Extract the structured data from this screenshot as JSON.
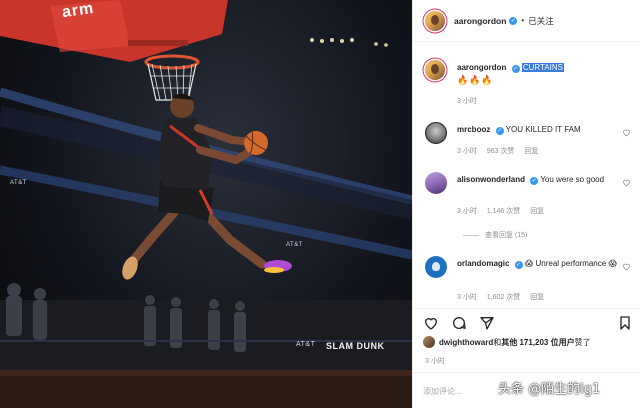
{
  "photo": {
    "description_icon": "basketball-dunk-photo",
    "backboard_text": "arm",
    "banner_text": "AT&T",
    "slam_dunk_text": "SLAM DUNK"
  },
  "header": {
    "username": "aarongordon",
    "verified_icon": "verified-badge-icon",
    "separator": "•",
    "follow_status": "已关注"
  },
  "caption": {
    "username": "aarongordon",
    "text": "CURTAINS",
    "emojis": "🔥🔥🔥",
    "time": "3 小时"
  },
  "comments": [
    {
      "username": "mrcbooz",
      "text": "YOU KILLED IT FAM",
      "time": "3 小时",
      "likes": "963 次赞",
      "reply": "回复"
    },
    {
      "username": "alisonwonderland",
      "text": "You were so good",
      "time": "3 小时",
      "likes": "1,146 次赞",
      "reply": "回复",
      "view_replies": "查看回复 (15)"
    },
    {
      "username": "orlandomagic",
      "text": "Unreal performance",
      "emoji_before": "😱",
      "emoji_after": "😱",
      "time": "3 小时",
      "likes": "1,602 次赞",
      "reply": "回复"
    }
  ],
  "likes_line": {
    "user": "dwighthoward",
    "connector": " 和 ",
    "others": "其他 171,203 位用户",
    "suffix": " 赞了"
  },
  "post_time": "3 小时",
  "comment_input": {
    "placeholder": "添加评论..."
  },
  "watermark": "头条 @陌生的lg1",
  "colors": {
    "accent_blue": "#3897f0",
    "highlight_blue": "#3a7be0",
    "muted_text": "#8e8e8e"
  }
}
